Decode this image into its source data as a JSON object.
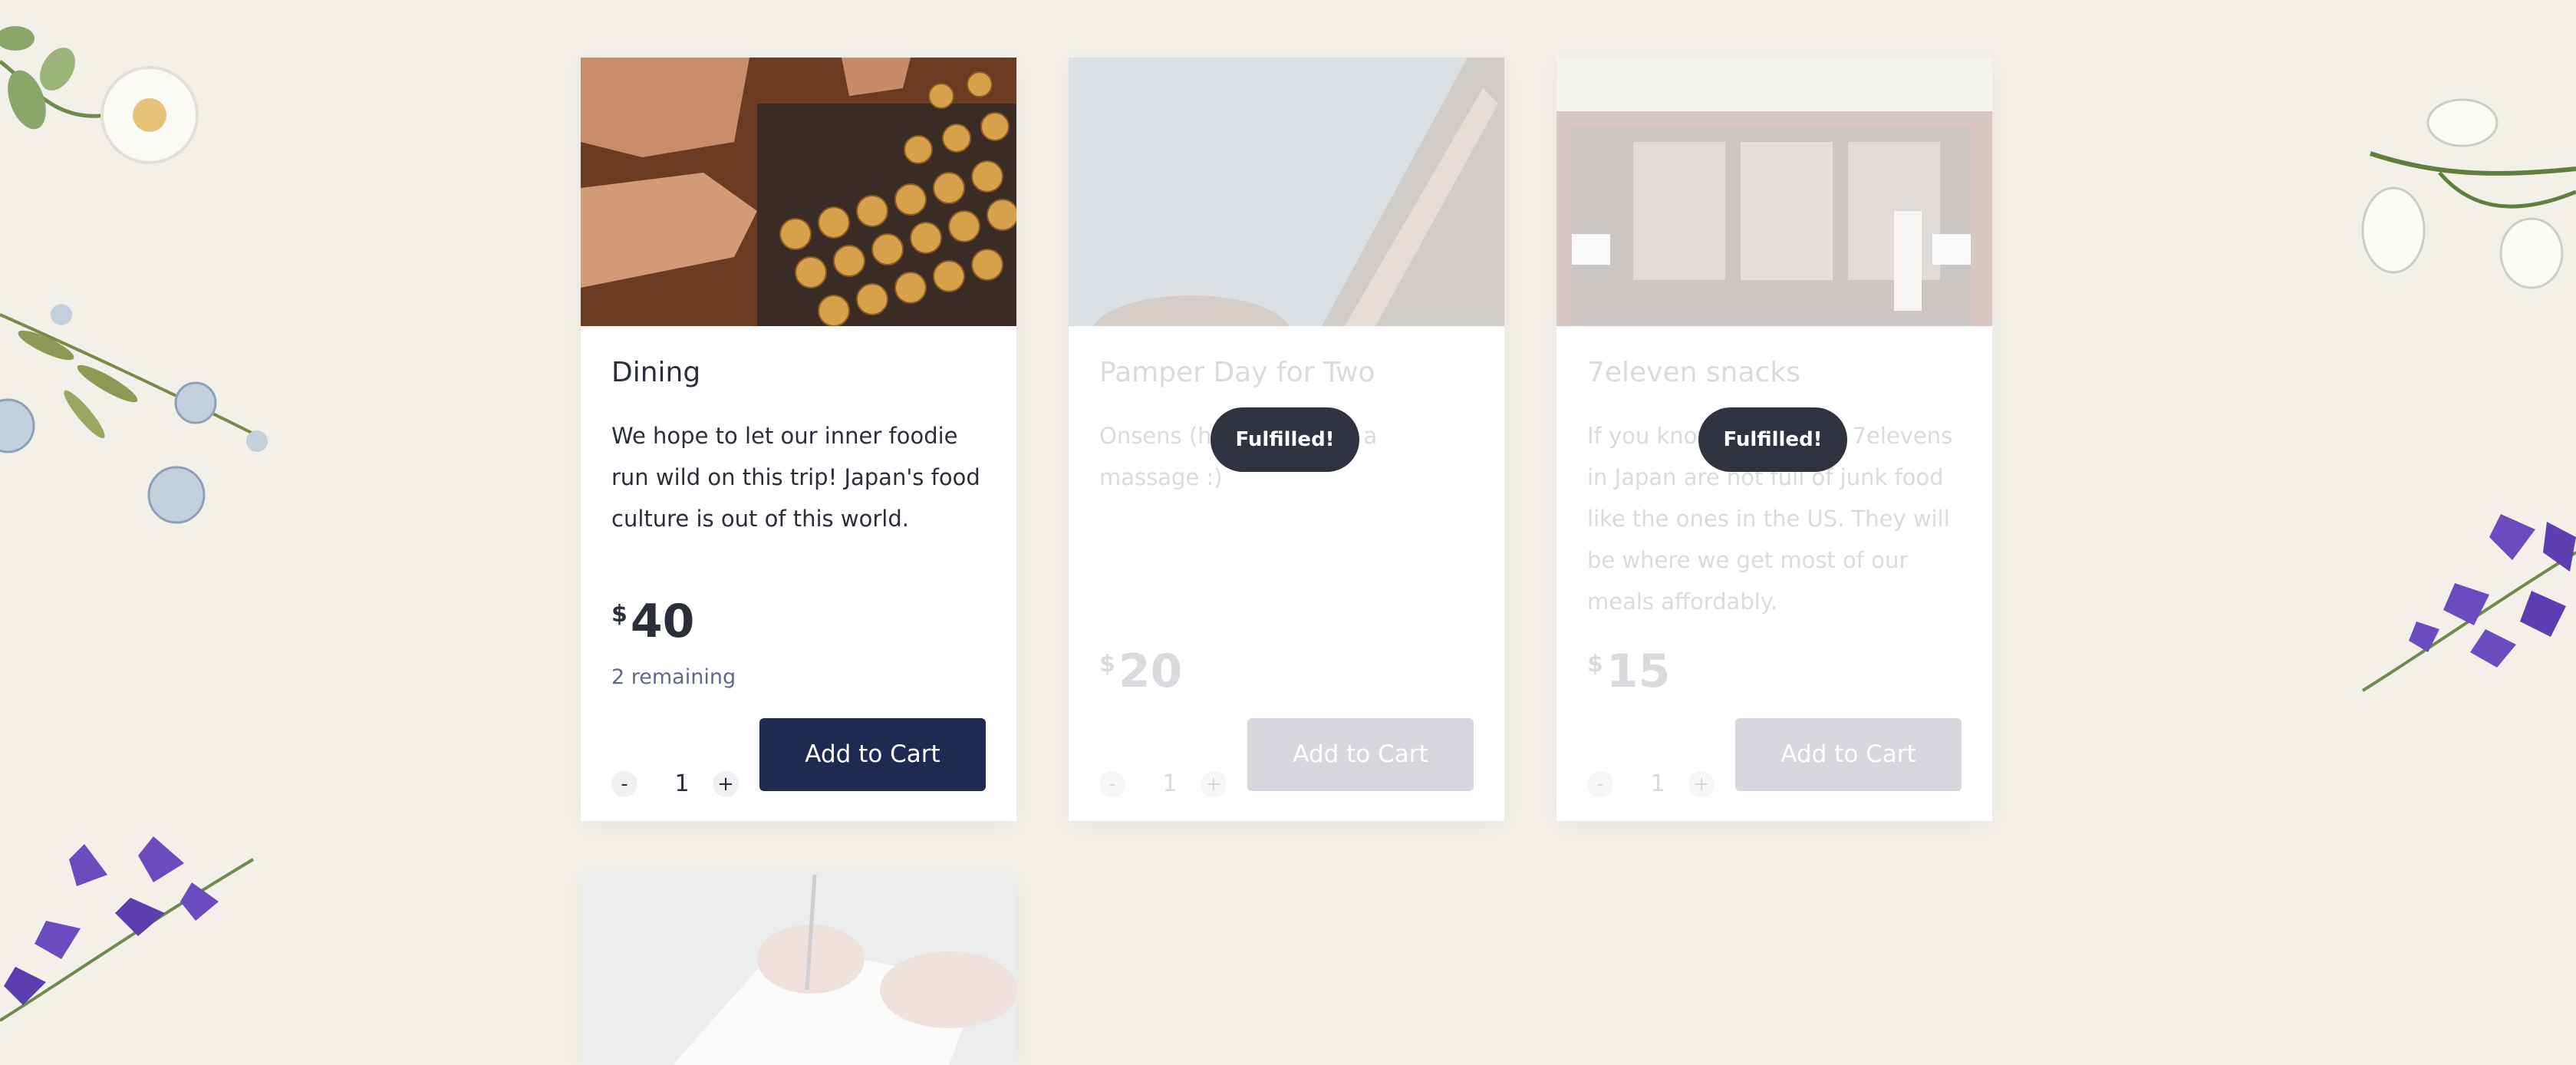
{
  "products": [
    {
      "title": "Dining",
      "description": "We hope to let our inner foodie run wild on this trip! Japan's food culture is out of this world.",
      "currency": "$",
      "price": "40",
      "remaining": "2 remaining",
      "quantity": "1",
      "minus": "-",
      "plus": "+",
      "cart_label": "Add to Cart",
      "status": ""
    },
    {
      "title": "Pamper Day for Two",
      "description": "Onsens (hot springs) + a massage :)",
      "currency": "$",
      "price": "20",
      "quantity": "1",
      "minus": "-",
      "plus": "+",
      "cart_label": "Add to Cart",
      "status": "Fulfilled!"
    },
    {
      "title": "7eleven snacks",
      "description": "If you know, you know! 7elevens in Japan are not full of junk food like the ones in the US. They will be where we get most of our meals affordably.",
      "currency": "$",
      "price": "15",
      "quantity": "1",
      "minus": "-",
      "plus": "+",
      "cart_label": "Add to Cart",
      "status": "Fulfilled!"
    }
  ],
  "colors": {
    "background": "#f3f0e9",
    "button_active": "#1f2a52",
    "button_disabled": "#d7d7dd",
    "status_pill": "#2f3340"
  }
}
